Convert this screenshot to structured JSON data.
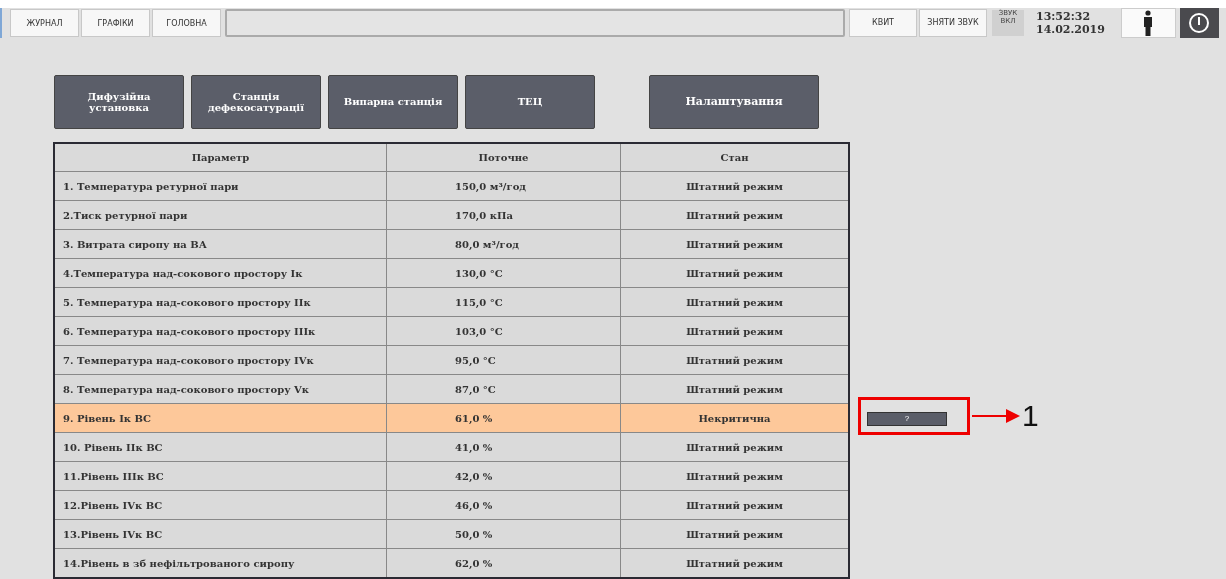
{
  "top_bar": {
    "tabs": [
      {
        "label": "ЖУРНАЛ",
        "selected": false
      },
      {
        "label": "ГРАФІКИ",
        "selected": false
      },
      {
        "label": "ГОЛОВНА",
        "selected": false
      }
    ],
    "buttons": [
      "КВИТ",
      "ЗНЯТИ ЗВУК"
    ],
    "sound_indicator": {
      "label": "ЗВУК ВКЛ",
      "on": false
    },
    "time": "13:52:32",
    "date": "14.02.2019"
  },
  "nav_buttons": [
    {
      "label": "Дифузійна установка",
      "kind": "section"
    },
    {
      "label": "Станція дефекосатурації",
      "kind": "section"
    },
    {
      "label": "Випарна станція",
      "kind": "section"
    },
    {
      "label": "ТЕЦ",
      "kind": "section"
    },
    {
      "label": "Налаштування",
      "kind": "settings"
    }
  ],
  "table": {
    "columns": [
      "Параметр",
      "Поточне",
      "Стан"
    ],
    "rows": [
      {
        "parameter": "1. Температура ретурної пари",
        "value": "150,0  м³/год",
        "state": "Штатний режим",
        "alert": false
      },
      {
        "parameter": "2.Тиск ретурної пари",
        "value": "170,0  кПа",
        "state": "Штатний режим",
        "alert": false
      },
      {
        "parameter": "3. Витрата сиропу на ВА",
        "value": "80,0  м³/год",
        "state": "Штатний режим",
        "alert": false
      },
      {
        "parameter": "4.Температура над-сокового простору Ік",
        "value": "130,0  °С",
        "state": "Штатний режим",
        "alert": false
      },
      {
        "parameter": "5. Температура над-сокового простору ІІк",
        "value": "115,0  °С",
        "state": "Штатний режим",
        "alert": false
      },
      {
        "parameter": "6. Температура над-сокового простору ІІІк",
        "value": "103,0  °С",
        "state": "Штатний режим",
        "alert": false
      },
      {
        "parameter": "7. Температура над-сокового простору ІVк",
        "value": "95,0  °С",
        "state": "Штатний режим",
        "alert": false
      },
      {
        "parameter": "8. Температура над-сокового простору Vк",
        "value": "87,0 °С",
        "state": "Штатний режим",
        "alert": false
      },
      {
        "parameter": "9. Рівень Ік ВС",
        "value": "61,0  %",
        "state": "Некритична",
        "alert": true,
        "help_button": "?",
        "annotation": "1"
      },
      {
        "parameter": "10. Рівень ІІк ВС",
        "value": "41,0  %",
        "state": "Штатний режим",
        "alert": false
      },
      {
        "parameter": "11.Рівень ІІІк ВС",
        "value": "42,0  %",
        "state": "Штатний режим",
        "alert": false
      },
      {
        "parameter": "12.Рівень ІVк ВС",
        "value": "46,0  %",
        "state": "Штатний режим",
        "alert": false
      },
      {
        "parameter": "13.Рівень ІVк ВС",
        "value": "50,0  %",
        "state": "Штатний режим",
        "alert": false
      },
      {
        "parameter": "14.Рівень в зб нефільтрованого сиропу",
        "value": "62,0  %",
        "state": "Штатний режим",
        "alert": false
      }
    ]
  }
}
